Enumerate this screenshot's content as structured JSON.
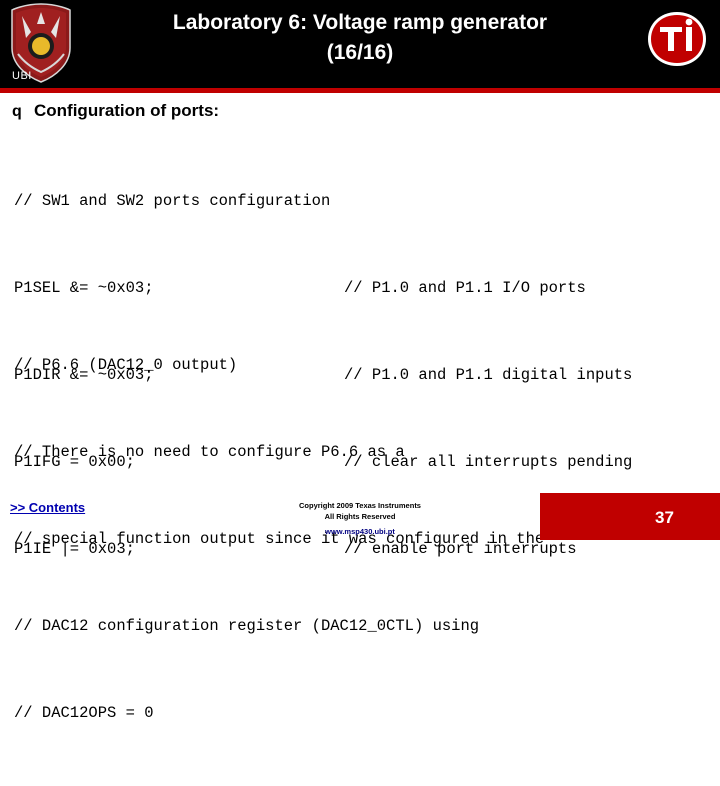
{
  "header": {
    "title_line1": "Laboratory 6: Voltage ramp generator",
    "title_line2": "(16/16)",
    "ubi_label": "UBI",
    "ti_logo_text": "Ti"
  },
  "slide": {
    "bullet_marker": "q",
    "bullet_text": "Configuration of ports:",
    "code_block_1": [
      {
        "code": "// SW1 and SW2 ports configuration",
        "comment": ""
      },
      {
        "code": "P1SEL &= ~0x03;",
        "comment": "// P1.0 and P1.1 I/O ports"
      },
      {
        "code": "P1DIR &= ~0x03;",
        "comment": "// P1.0 and P1.1 digital inputs"
      },
      {
        "code": "P1IFG = 0x00;",
        "comment": "// clear all interrupts pending"
      },
      {
        "code": "P1IE |= 0x03;",
        "comment": "// enable port interrupts"
      }
    ],
    "code_block_2": [
      {
        "code": "// P6.6 (DAC12_0 output)",
        "comment": ""
      },
      {
        "code": "// There is no need to configure P6.6 as a",
        "comment": ""
      },
      {
        "code": "// special function output since it was configured in the",
        "comment": ""
      },
      {
        "code": "// DAC12 configuration register (DAC12_0CTL) using",
        "comment": ""
      },
      {
        "code": "// DAC12OPS = 0",
        "comment": ""
      }
    ]
  },
  "footer": {
    "contents_link": ">> Contents",
    "copyright_line1": "Copyright  2009 Texas Instruments",
    "copyright_line2": "All Rights Reserved",
    "url": "www.msp430.ubi.pt",
    "page_number": "37"
  },
  "colors": {
    "header_bg": "#000000",
    "accent_red": "#c00000",
    "link_blue": "#0000b0"
  }
}
